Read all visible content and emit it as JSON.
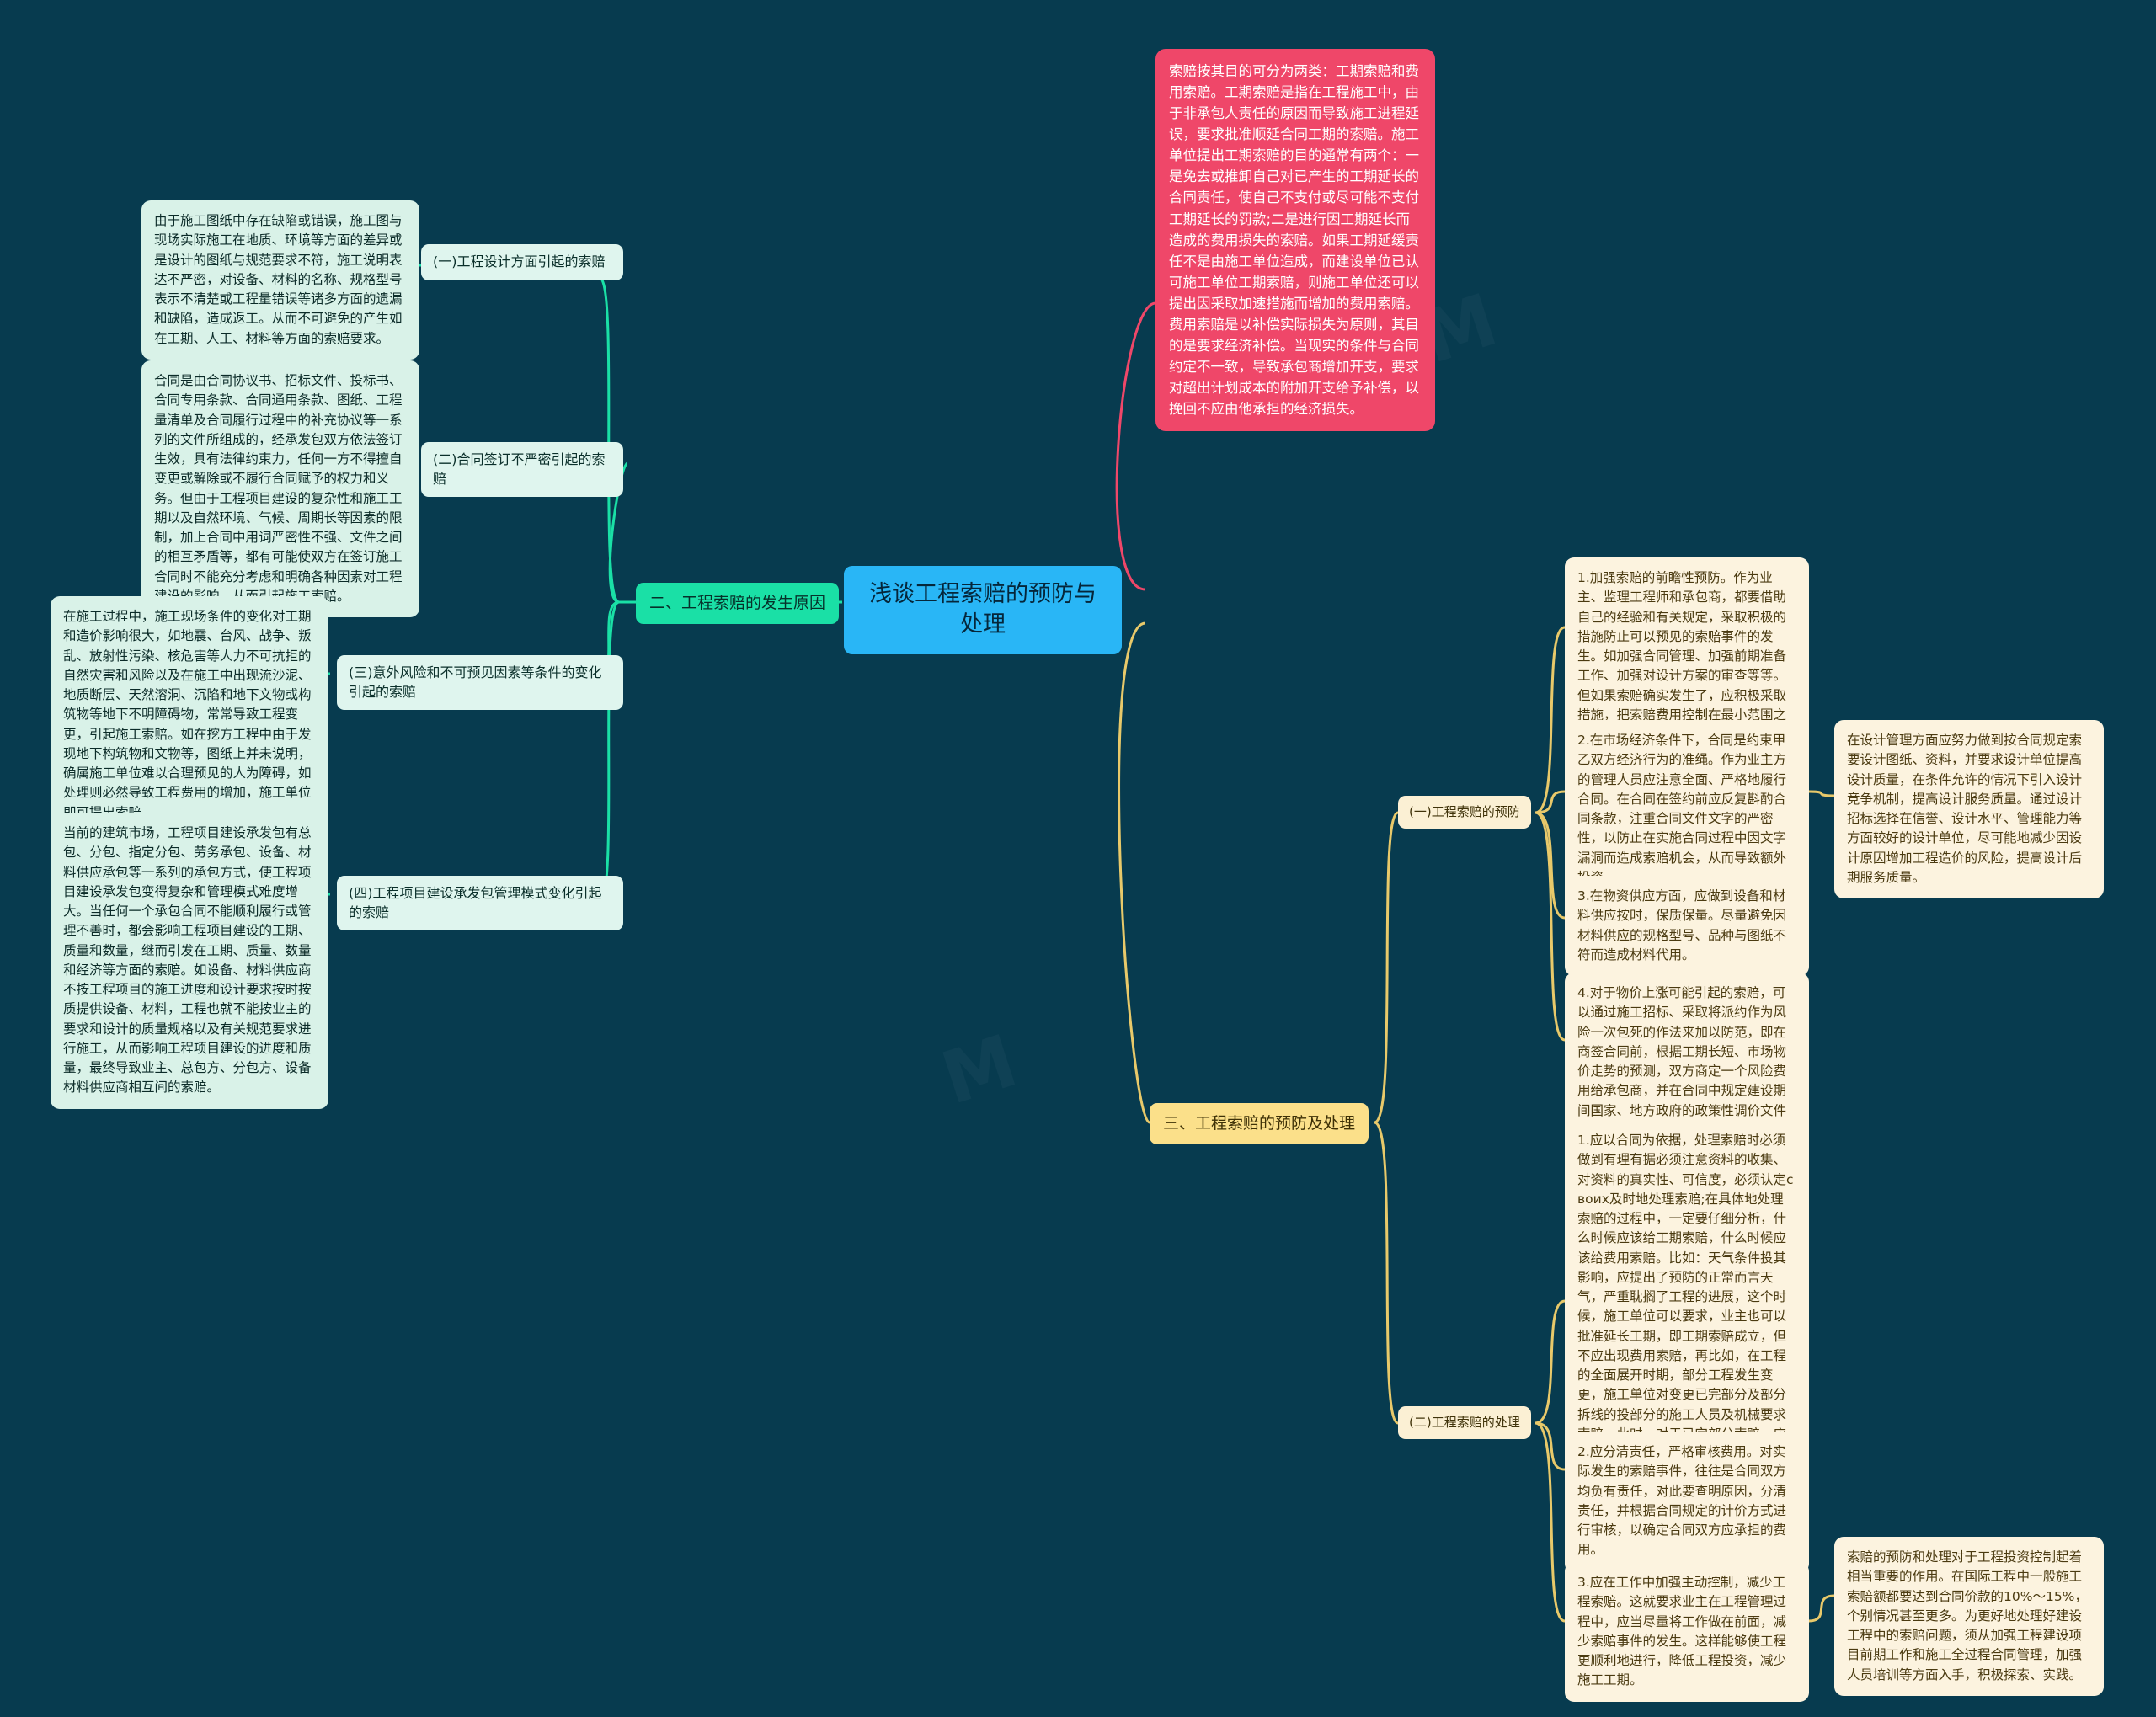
{
  "root": {
    "title": "浅谈工程索赔的预防与处理",
    "color": "#29b6f6"
  },
  "topic_pink": {
    "text": "索赔按其目的可分为两类：工期索赔和费用索赔。工期索赔是指在工程施工中，由于非承包人责任的原因而导致施工进程延误，要求批准顺延合同工期的索赔。施工单位提出工期索赔的目的通常有两个：一是免去或推卸自己对已产生的工期延长的合同责任，使自己不支付或尽可能不支付工期延长的罚款;二是进行因工期延长而造成的费用损失的索赔。如果工期延缓责任不是由施工单位造成，而建设单位已认可施工单位工期索赔，则施工单位还可以提出因采取加速措施而增加的费用索赔。费用索赔是以补偿实际损失为原则，其目的是要求经济补偿。当现实的条件与合同约定不一致，导致承包商增加开支，要求对超出计划成本的附加开支给予补偿，以挽回不应由他承担的经济损失。",
    "color": "#ef4769"
  },
  "branch_green": {
    "label": "二、工程索赔的发生原因",
    "color": "#1ae0a6",
    "subs": [
      {
        "label": "(一)工程设计方面引起的索赔",
        "leaf": "由于施工图纸中存在缺陷或错误，施工图与现场实际施工在地质、环境等方面的差异或是设计的图纸与规范要求不符，施工说明表达不严密，对设备、材料的名称、规格型号表示不清楚或工程量错误等诸多方面的遗漏和缺陷，造成返工。从而不可避免的产生如在工期、人工、材料等方面的索赔要求。"
      },
      {
        "label": "(二)合同签订不严密引起的索赔",
        "leaf": "合同是由合同协议书、招标文件、投标书、合同专用条款、合同通用条款、图纸、工程量清单及合同履行过程中的补充协议等一系列的文件所组成的，经承发包双方依法签订生效，具有法律约束力，任何一方不得擅自变更或解除或不履行合同赋予的权力和义务。但由于工程项目建设的复杂性和施工工期以及自然环境、气候、周期长等因素的限制，加上合同中用词严密性不强、文件之间的相互矛盾等，都有可能使双方在签订施工合同时不能充分考虑和明确各种因素对工程建设的影响，从而引起施工索赔。"
      },
      {
        "label": "(三)意外风险和不可预见因素等条件的变化引起的索赔",
        "leaf": "在施工过程中，施工现场条件的变化对工期和造价影响很大，如地震、台风、战争、叛乱、放射性污染、核危害等人力不可抗拒的自然灾害和风险以及在施工中出现流沙泥、地质断层、天然溶洞、沉陷和地下文物或构筑物等地下不明障碍物，常常导致工程变更，引起施工索赔。如在挖方工程中由于发现地下构筑物和文物等，图纸上并未说明，确属施工单位难以合理预见的人为障碍，如处理则必然导致工程费用的增加，施工单位即可提出索赔。"
      },
      {
        "label": "(四)工程项目建设承发包管理模式变化引起的索赔",
        "leaf": "当前的建筑市场，工程项目建设承发包有总包、分包、指定分包、劳务承包、设备、材料供应承包等一系列的承包方式，使工程项目建设承发包变得复杂和管理模式难度增大。当任何一个承包合同不能顺利履行或管理不善时，都会影响工程项目建设的工期、质量和数量，继而引发在工期、质量、数量和经济等方面的索赔。如设备、材料供应商不按工程项目的施工进度和设计要求按时按质提供设备、材料，工程也就不能按业主的要求和设计的质量规格以及有关规范要求进行施工，从而影响工程项目建设的进度和质量，最终导致业主、总包方、分包方、设备材料供应商相互间的索赔。"
      }
    ]
  },
  "branch_amber": {
    "label": "三、工程索赔的预防及处理",
    "color": "#fbe08a",
    "subs": [
      {
        "label": "(一)工程索赔的预防",
        "leaves": [
          "1.加强索赔的前瞻性预防。作为业主、监理工程师和承包商，都要借助自己的经验和有关规定，采取积极的措施防止可以预见的索赔事件的发生。如加强合同管理、加强前期准备工作、加强对设计方案的审查等等。但如果索赔确实发生了，应积极采取措施，把索赔费用控制在最小范围之内。",
          "2.在市场经济条件下，合同是约束甲乙双方经济行为的准绳。作为业主方的管理人员应注意全面、严格地履行合同。在合同在签约前应反复斟酌合同条款，注重合同文件文字的严密性，以防止在实施合同过程中因文字漏洞而造成索赔机会，从而导致额外投资。",
          "3.在物资供应方面，应做到设备和材料供应按时，保质保量。尽量避免因材料供应的规格型号、品种与图纸不符而造成材料代用。",
          "4.对于物价上涨可能引起的索赔，可以通过施工招标、采取将派约作为风险一次包死的作法来加以防范，即在商签合同前，根据工期长短、市场物价走势的预测，双方商定一个风险费用给承包商，并在合同中规定建设期间国家、地方政府的政策性调价文件一律不再执行。"
        ],
        "side_leaf": "在设计管理方面应努力做到按合同规定索要设计图纸、资料，并要求设计单位提高设计质量，在条件允许的情况下引入设计竞争机制，提高设计服务质量。通过设计招标选择在信誉、设计水平、管理能力等方面较好的设计单位，尽可能地减少因设计原因增加工程造价的风险，提高设计后期服务质量。"
      },
      {
        "label": "(二)工程索赔的处理",
        "leaves": [
          "1.应以合同为依据，处理索赔时必须做到有理有据必须注意资料的收集、对资料的真实性、可信度，必须认定своих及时地处理索赔;在具体地处理索赔的过程中，一定要仔细分析，什么时候应该给工期索赔，什么时候应该给费用索赔。比如：天气条件投其影响，应提出了预防的正常而言天气，严重耽搁了工程的进展，这个时候，施工单位可以要求，业主也可以批准延长工期，即工期索赔成立，但不应出现费用索赔，再比如，在工程的全面展开时期，部分工程发生变更，施工单位对变更已完部分及部分拆线的投部分的施工人员及机械要求索赔，此时，对于已完部分索赔，应该全部给付，其中包括成本和利润，但对于停滞的人员和机械，由于正值施工旺季，完全可以先把此部分人员、机械调到别处使用，所应提付的应该只是更换工作地点及工种的工效降低费。",
          "2.应分清责任，严格审核费用。对实际发生的索赔事件，往往是合同双方均负有责任，对此要查明原因，分清责任，并根据合同规定的计价方式进行审核，以确定合同双方应承担的费用。",
          "3.应在工作中加强主动控制，减少工程索赔。这就要求业主在工程管理过程中，应当尽量将工作做在前面，减少索赔事件的发生。这样能够使工程更顺利地进行，降低工程投资，减少施工工期。"
        ],
        "side_leaf": "索赔的预防和处理对于工程投资控制起着相当重要的作用。在国际工程中一般施工索赔额都要达到合同价款的10%～15%，个别情况甚至更多。为更好地处理好建设工程中的索赔问题，须从加强工程建设项目前期工作和施工全过程合同管理，加强人员培训等方面入手，积极探索、实践。"
      }
    ]
  }
}
